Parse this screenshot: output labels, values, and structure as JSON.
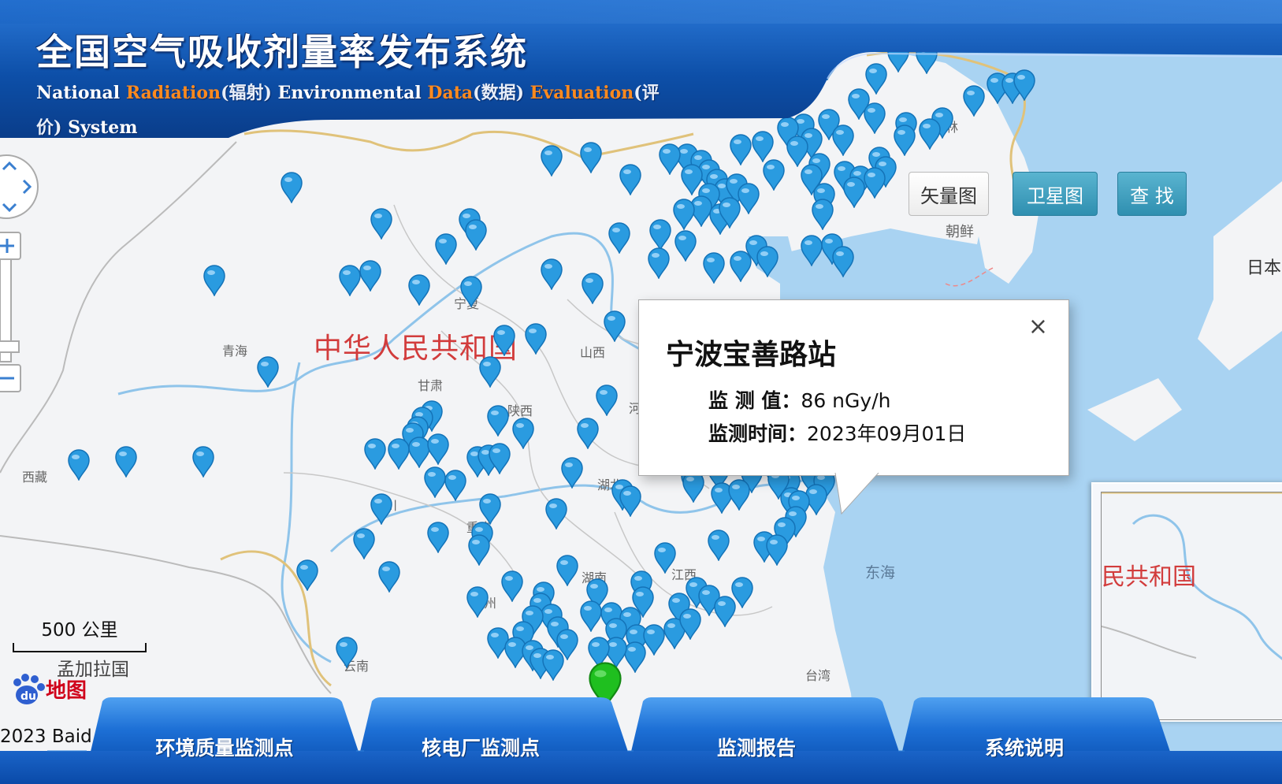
{
  "header": {
    "title": "全国空气吸收剂量率发布系统",
    "subtitle_parts": [
      {
        "text": "National ",
        "style": "plain"
      },
      {
        "text": "Radiation",
        "style": "highlight"
      },
      {
        "text": "(辐射) ",
        "style": "cn"
      },
      {
        "text": "Environmental ",
        "style": "plain"
      },
      {
        "text": "Data",
        "style": "highlight"
      },
      {
        "text": "(数据) ",
        "style": "cn"
      },
      {
        "text": "Evaluation",
        "style": "highlight"
      },
      {
        "text": "(评价) ",
        "style": "cn"
      },
      {
        "text": "System",
        "style": "plain"
      }
    ]
  },
  "map_type_buttons": {
    "vector": "矢量图",
    "satellite": "卫星图",
    "search": "查 找"
  },
  "map_labels": {
    "country": "中华人民共和国",
    "inset_country": "民共和国",
    "provinces": [
      "吉林",
      "宁夏",
      "青海",
      "甘肃",
      "山西",
      "陕西",
      "西藏",
      "四川",
      "重庆",
      "湖北",
      "湖南",
      "江西",
      "贵州",
      "云南",
      "台湾",
      "河"
    ],
    "foreign": [
      "朝鲜",
      "日本",
      "孟加拉国"
    ],
    "seas": [
      "东海"
    ]
  },
  "info_window": {
    "station_name": "宁波宝善路站",
    "value_label": "监 测 值：",
    "value": "86 nGy/h",
    "time_label": "监测时间：",
    "time": "2023年09月01日",
    "close_symbol": "×"
  },
  "scale_bar": {
    "label": "500 公里"
  },
  "baidu": {
    "logo_text": "地图",
    "copyright": "2023 Baid"
  },
  "nav": [
    "环境质量监测点",
    "核电厂监测点",
    "监测报告",
    "系统说明"
  ],
  "colors": {
    "pin": "#2a9be0",
    "selected_pin": "#1fbf1f",
    "sea": "#a9d3f2",
    "land": "#f3f4f6",
    "header_blue": "#0d4fa8",
    "highlight_orange": "#ff8a1e",
    "country_label": "#d23c3c"
  }
}
